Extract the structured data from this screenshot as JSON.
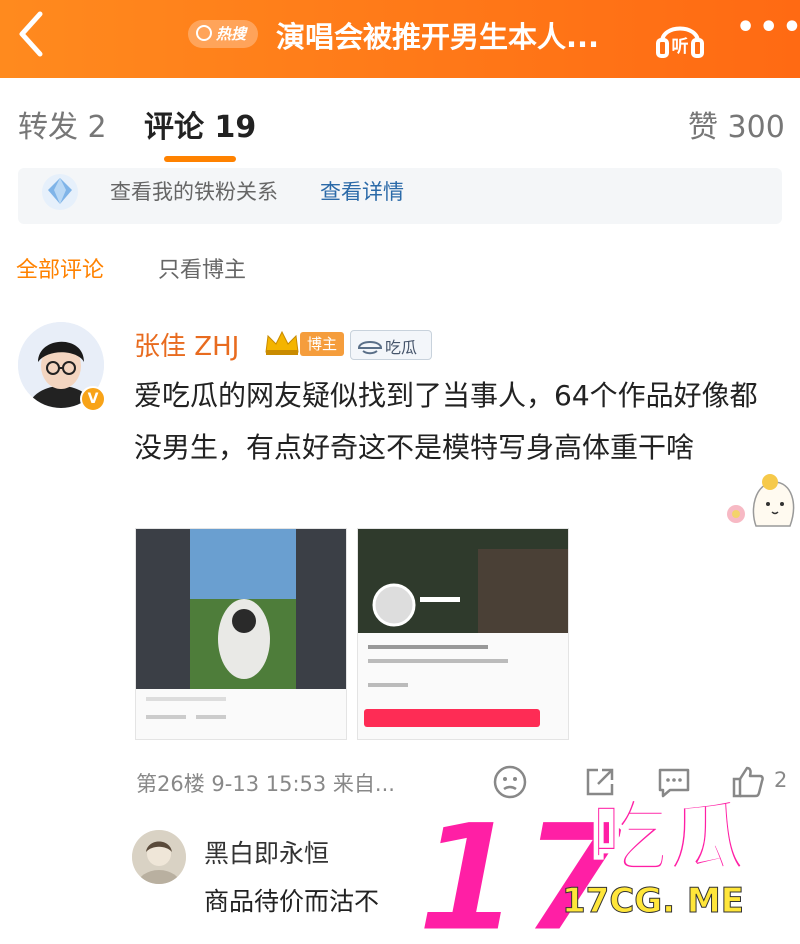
{
  "header": {
    "back_icon": "chevron-left-icon",
    "hot_badge": "热搜",
    "title": "演唱会被推开男生本人...",
    "listen_icon": "headphones-icon",
    "listen_label": "听",
    "more_icon": "more-dots-icon",
    "more_label": "•••"
  },
  "tabs": [
    {
      "label": "转发 2"
    },
    {
      "label": "评论 19",
      "active": true
    },
    {
      "label": "赞 300"
    }
  ],
  "fan_bar": {
    "text": "查看我的铁粉关系",
    "link": "查看详情"
  },
  "filters": {
    "all": "全部评论",
    "poster_only": "只看博主"
  },
  "comment": {
    "username": "张佳 ZHJ",
    "poster_tag": "博主",
    "melon_tag": "吃瓜",
    "verified_badge": "V",
    "text": "爱吃瓜的网友疑似找到了当事人，64个作品好像都没男生，有点好奇这不是模特写身高体重干啥",
    "meta": "第26楼  9-13 15:53  来自...",
    "like_count": "2"
  },
  "reply": {
    "name": "黑白即永恒",
    "text": "商品待价而沽不"
  },
  "watermark": {
    "big": "17",
    "cn": "吃瓜",
    "url": "17CG. ME"
  },
  "colors": {
    "header_gradient_start": "#ff8a1e",
    "header_gradient_end": "#ff6a13",
    "accent_orange": "#ff8200",
    "username_orange": "#e86b1f",
    "link_blue": "#2b6aa8",
    "watermark_magenta": "#ff1fa5",
    "watermark_yellow": "#ffe63a"
  }
}
